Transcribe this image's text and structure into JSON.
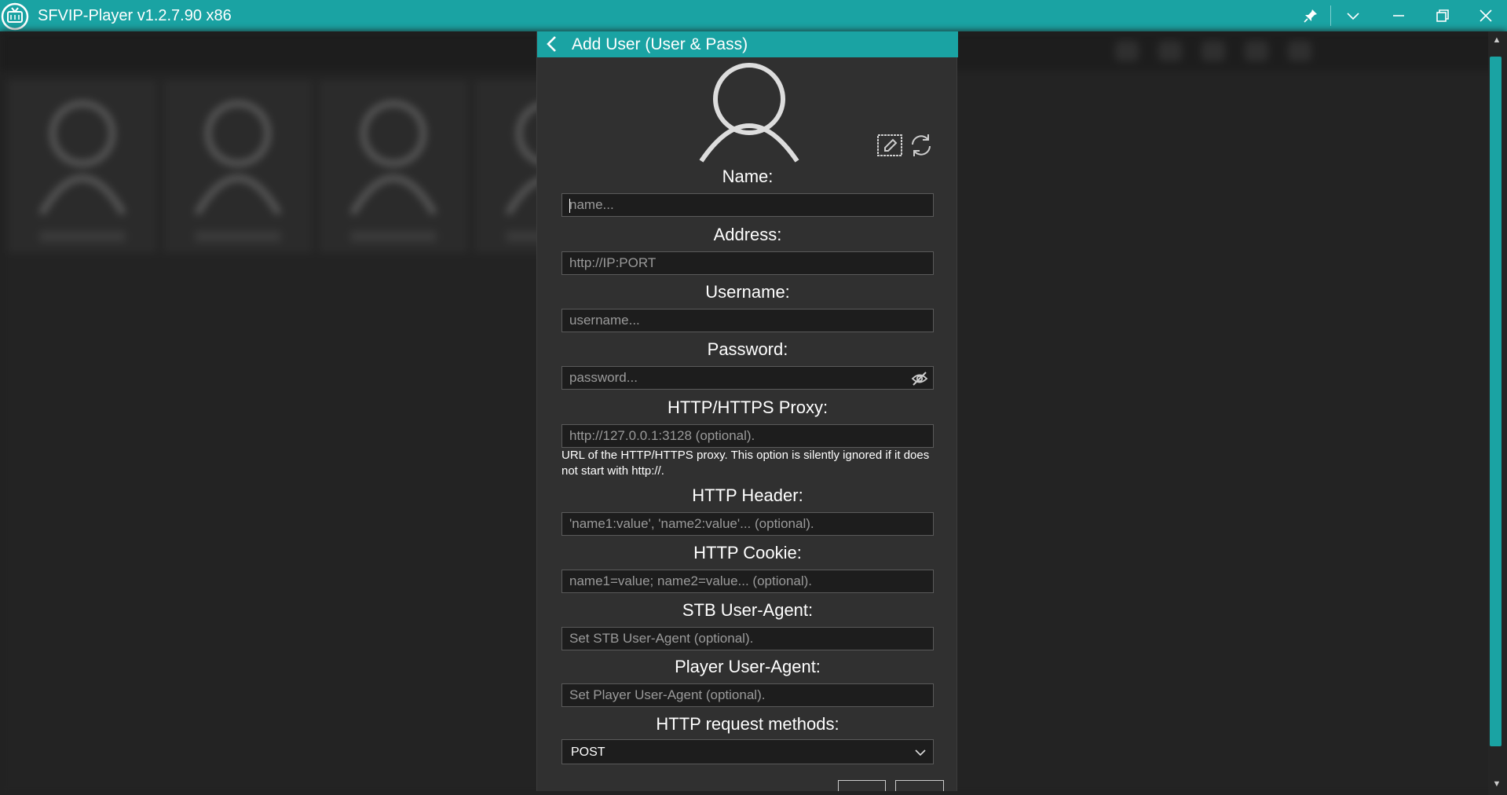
{
  "window": {
    "title": "SFVIP-Player v1.2.7.90 x86"
  },
  "dialog": {
    "title": "Add User (User & Pass)"
  },
  "form": {
    "name": {
      "label": "Name:",
      "placeholder": "name..."
    },
    "address": {
      "label": "Address:",
      "placeholder": "http://IP:PORT"
    },
    "username": {
      "label": "Username:",
      "placeholder": "username..."
    },
    "password": {
      "label": "Password:",
      "placeholder": "password..."
    },
    "proxy": {
      "label": "HTTP/HTTPS Proxy:",
      "placeholder": "http://127.0.0.1:3128 (optional).",
      "hint": "URL of the HTTP/HTTPS proxy. This option is silently ignored if it does not start with http://."
    },
    "header": {
      "label": "HTTP Header:",
      "placeholder": "'name1:value', 'name2:value'... (optional)."
    },
    "cookie": {
      "label": "HTTP Cookie:",
      "placeholder": "name1=value; name2=value... (optional)."
    },
    "stb_agent": {
      "label": "STB User-Agent:",
      "placeholder": "Set STB User-Agent (optional)."
    },
    "player_agent": {
      "label": "Player User-Agent:",
      "placeholder": "Set Player User-Agent (optional)."
    },
    "methods": {
      "label": "HTTP request methods:",
      "value": "POST"
    }
  },
  "icons": {
    "app": "tv-logo-icon",
    "pin": "pin-icon",
    "dropdown": "chevron-down-icon",
    "minimize": "minimize-icon",
    "restore": "restore-icon",
    "close": "close-icon",
    "back": "back-arrow-icon",
    "avatar": "user-avatar-icon",
    "edit_image": "edit-image-icon",
    "refresh": "refresh-icon",
    "password_toggle": "eye-off-icon"
  },
  "colors": {
    "accent": "#1aa3a3",
    "panel": "#303030",
    "field": "#1d1d1d",
    "text": "#ffffff"
  }
}
